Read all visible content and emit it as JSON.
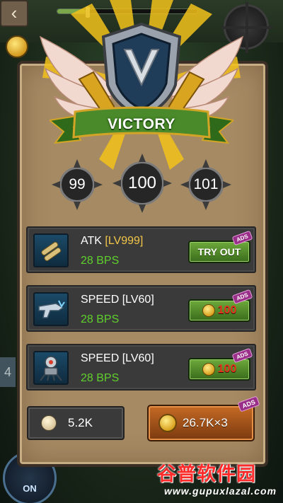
{
  "topbar": {
    "back_icon": "chevron-left-icon",
    "progress": 0.2
  },
  "side": {
    "left_tab_label": "4",
    "toggle_label": "ON"
  },
  "result": {
    "title": "VICTORY",
    "accent_color": "#4a8a2a"
  },
  "levels": {
    "previous": "99",
    "current": "100",
    "next": "101"
  },
  "rewards": [
    {
      "icon": "bullets-icon",
      "name": "ATK ",
      "level_tag": "[LV999]",
      "bps": "28 BPS",
      "action_label": "TRY OUT",
      "price": "",
      "ads_label": "ADS"
    },
    {
      "icon": "gun-icon",
      "name": "SPEED [LV60]",
      "level_tag": "",
      "bps": "28 BPS",
      "action_label": "",
      "price": "100",
      "ads_label": "ADS"
    },
    {
      "icon": "robot-icon",
      "name": "SPEED [LV60]",
      "level_tag": "",
      "bps": "28 BPS",
      "action_label": "",
      "price": "100",
      "ads_label": "ADS"
    }
  ],
  "collect": {
    "normal_amount": "5.2K",
    "multiplied_amount": "26.7K×3",
    "ads_label": "ADS"
  },
  "watermark": {
    "title": "谷普软件园",
    "url": "www.gupuxlazal.com"
  }
}
